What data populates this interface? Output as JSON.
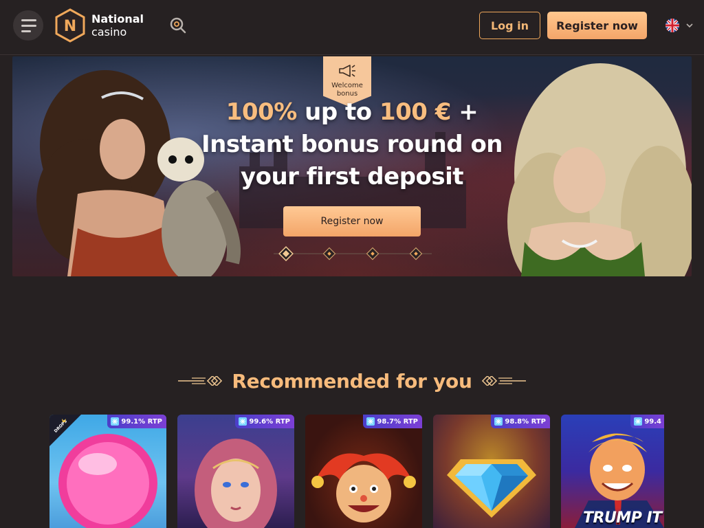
{
  "header": {
    "logo_line1": "National",
    "logo_line2": "casino",
    "logo_letter": "N",
    "menu_icon": "hamburger-menu-icon",
    "search_icon": "search-icon",
    "login_label": "Log in",
    "register_label": "Register now",
    "language_flag": "uk-flag-icon",
    "accent_color": "#f3a569"
  },
  "hero": {
    "badge_line1": "Welcome",
    "badge_line2": "bonus",
    "title_highlight1": "100%",
    "title_mid": " up to ",
    "title_highlight2": "100 €",
    "title_plus": " +",
    "title_line2": "Instant bonus round on",
    "title_line3": "your first deposit",
    "cta_label": "Register now",
    "slides_count": 4,
    "active_slide": 1
  },
  "recommended": {
    "title": "Recommended for you",
    "games": [
      {
        "rtp": "99.1% RTP",
        "art": "pink-candy",
        "drops_badge": "DROPS & WINS"
      },
      {
        "rtp": "99.6% RTP",
        "art": "fantasy-woman"
      },
      {
        "rtp": "98.7% RTP",
        "art": "jester"
      },
      {
        "rtp": "98.8% RTP",
        "art": "diamond"
      },
      {
        "rtp": "99.4",
        "art": "trump-caricature",
        "caption": "TRUMP IT"
      }
    ]
  }
}
